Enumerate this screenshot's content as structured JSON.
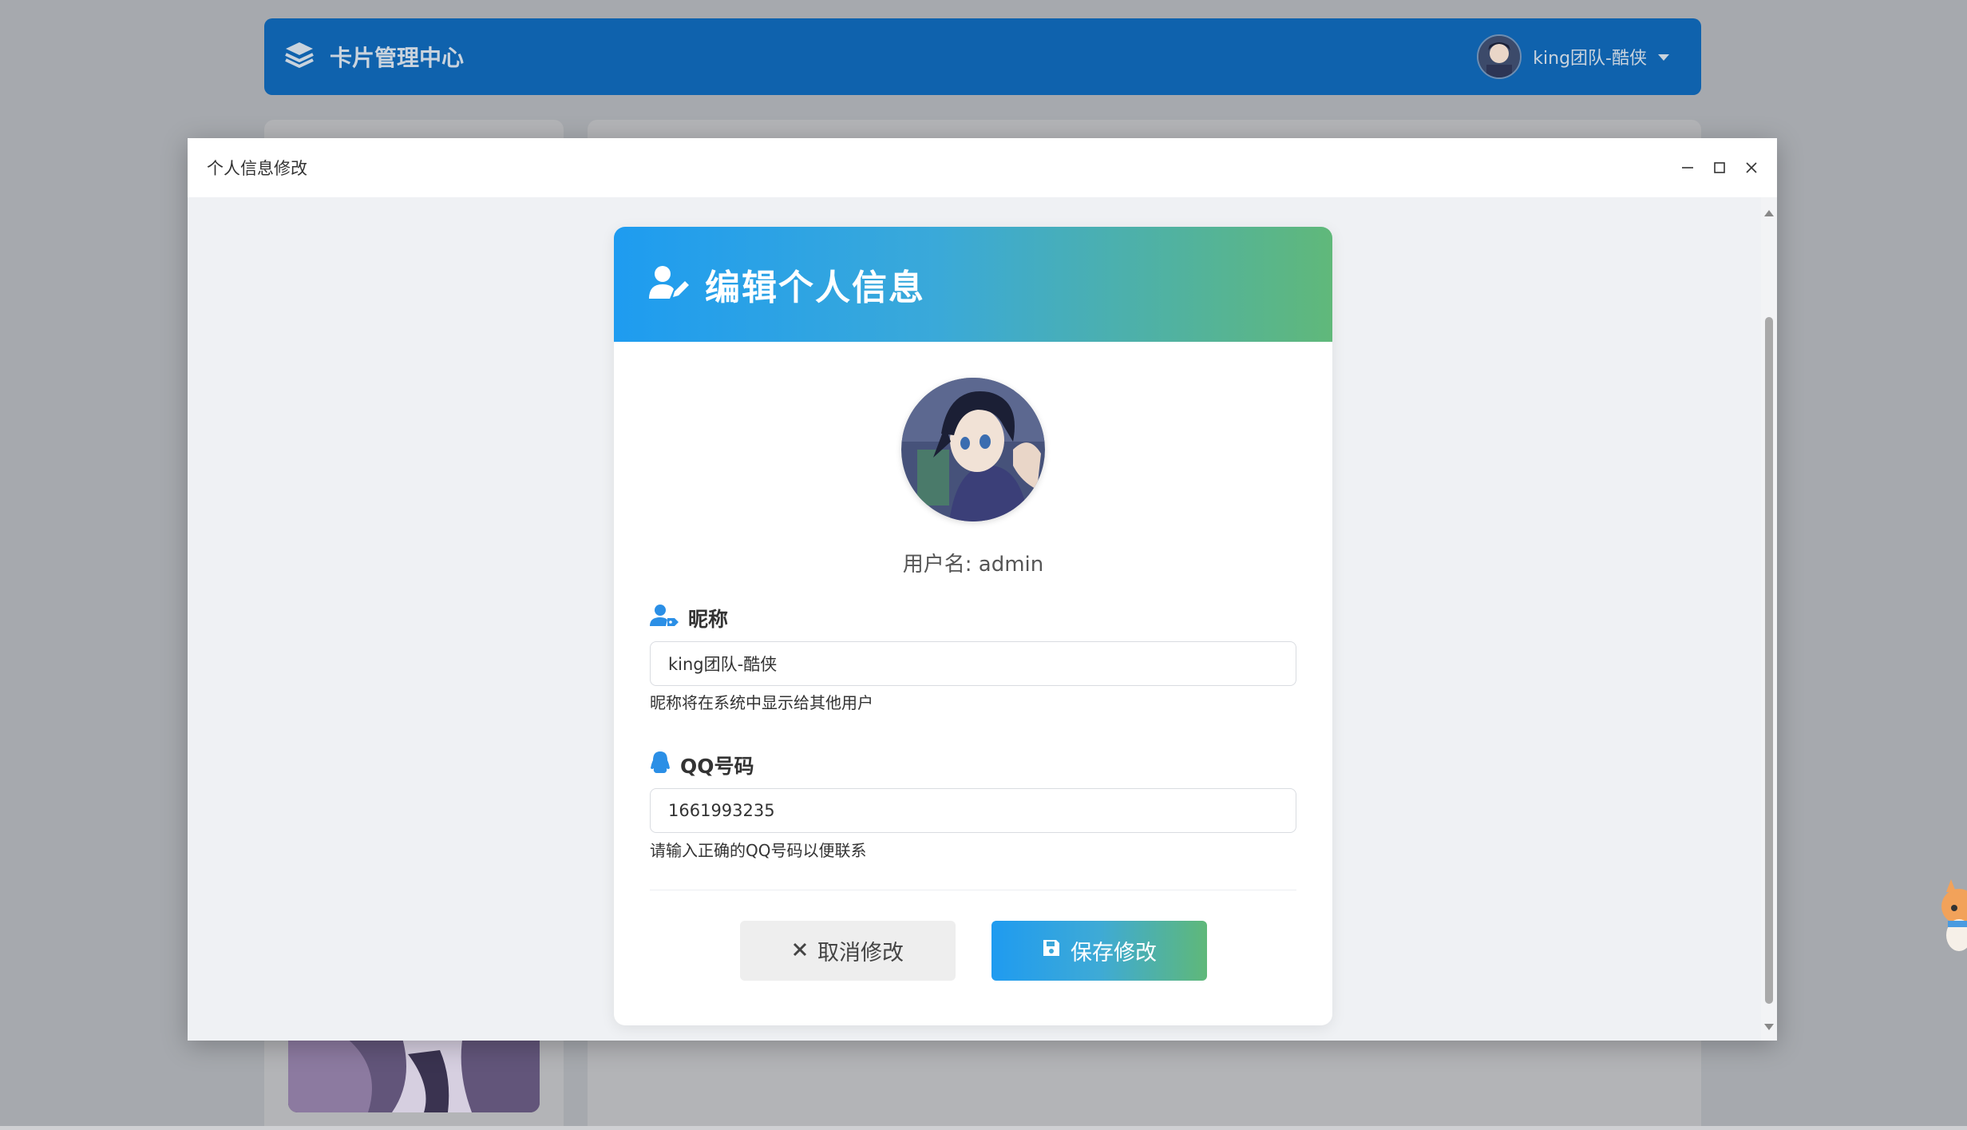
{
  "app": {
    "brand_title": "卡片管理中心",
    "user_name": "king团队-酷侠"
  },
  "modal": {
    "title": "个人信息修改"
  },
  "card": {
    "title": "编辑个人信息",
    "username_line": "用户名: admin",
    "nickname": {
      "label": "昵称",
      "value": "king团队-酷侠",
      "hint": "昵称将在系统中显示给其他用户"
    },
    "qq": {
      "label": "QQ号码",
      "value": "1661993235",
      "hint": "请输入正确的QQ号码以便联系"
    },
    "cancel_label": "取消修改",
    "save_label": "保存修改"
  },
  "icons": {
    "brand": "layers-icon",
    "user_dropdown": "caret-down-icon",
    "header": "user-edit-icon",
    "nickname": "user-tag-icon",
    "qq": "qq-penguin-icon",
    "cancel": "close-icon",
    "save": "floppy-disk-icon",
    "minimize": "minimize-icon",
    "maximize": "maximize-icon",
    "close": "close-icon"
  },
  "colors": {
    "topbar": "#0f62ad",
    "accent_start": "#1e9cf0",
    "accent_end": "#60b87a",
    "cancel_bg": "#eeeeee"
  }
}
